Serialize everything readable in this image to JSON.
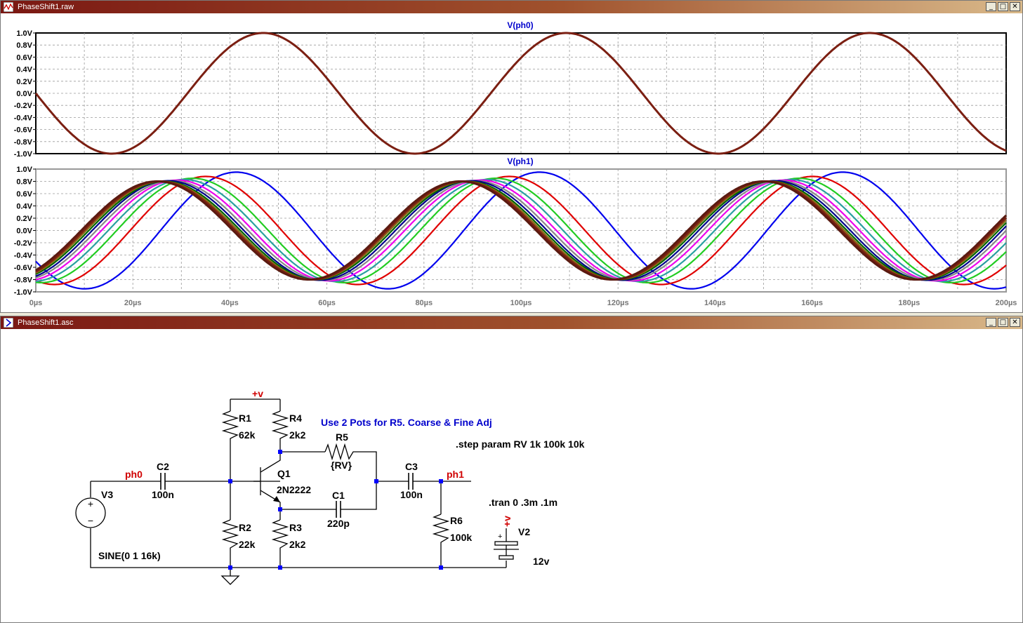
{
  "waveform_window": {
    "title": "PhaseShift1.raw",
    "buttons": {
      "minimize": "_",
      "maximize": "□",
      "close": "✕"
    }
  },
  "schematic_window": {
    "title": "PhaseShift1.asc",
    "buttons": {
      "minimize": "_",
      "maximize": "□",
      "close": "✕"
    }
  },
  "chart_data": [
    {
      "type": "line",
      "title": "V(ph0)",
      "xlim": [
        0,
        200
      ],
      "ylim": [
        -1.0,
        1.0
      ],
      "ytick_labels": [
        "1.0V",
        "0.8V",
        "0.6V",
        "0.4V",
        "0.2V",
        "0.0V",
        "-0.2V",
        "-0.4V",
        "-0.6V",
        "-0.8V",
        "-1.0V"
      ],
      "grid": true,
      "series": [
        {
          "color": "#7b1f12",
          "amplitude": 1.0,
          "phase_deg": 180,
          "frequency_khz": 16
        }
      ]
    },
    {
      "type": "line",
      "title": "V(ph1)",
      "xlim": [
        0,
        200
      ],
      "ylim": [
        -1.0,
        1.0
      ],
      "ytick_labels": [
        "1.0V",
        "0.8V",
        "0.6V",
        "0.4V",
        "0.2V",
        "0.0V",
        "-0.2V",
        "-0.4V",
        "-0.6V",
        "-0.8V",
        "-1.0V"
      ],
      "xtick_labels": [
        "0µs",
        "20µs",
        "40µs",
        "60µs",
        "80µs",
        "100µs",
        "120µs",
        "140µs",
        "160µs",
        "180µs",
        "200µs"
      ],
      "grid": true,
      "series": [
        {
          "color": "#0000ee",
          "amplitude": 0.95,
          "phase_deg": 212
        },
        {
          "color": "#e00000",
          "amplitude": 0.88,
          "phase_deg": 248
        },
        {
          "color": "#22cc22",
          "amplitude": 0.85,
          "phase_deg": 264
        },
        {
          "color": "#2aa0a0",
          "amplitude": 0.83,
          "phase_deg": 274
        },
        {
          "color": "#ee00ee",
          "amplitude": 0.82,
          "phase_deg": 282
        },
        {
          "color": "#888888",
          "amplitude": 0.81,
          "phase_deg": 288
        },
        {
          "color": "#00008b",
          "amplitude": 0.81,
          "phase_deg": 293
        },
        {
          "color": "#006400",
          "amplitude": 0.8,
          "phase_deg": 297
        },
        {
          "color": "#8b6914",
          "amplitude": 0.8,
          "phase_deg": 300
        },
        {
          "color": "#7b1f12",
          "amplitude": 0.8,
          "phase_deg": 303
        },
        {
          "color": "#5a1a10",
          "amplitude": 0.8,
          "phase_deg": 306
        }
      ]
    }
  ],
  "schematic": {
    "net_labels": {
      "ph0": "ph0",
      "ph1": "ph1",
      "vplus1": "+v",
      "vplus2": "+v"
    },
    "comment": "Use 2 Pots for R5. Coarse & Fine Adj",
    "directive_step": ".step param RV 1k  100k 10k",
    "directive_tran": ".tran 0 .3m .1m",
    "components": {
      "R1": {
        "name": "R1",
        "value": "62k"
      },
      "R2": {
        "name": "R2",
        "value": "22k"
      },
      "R3": {
        "name": "R3",
        "value": "2k2"
      },
      "R4": {
        "name": "R4",
        "value": "2k2"
      },
      "R5": {
        "name": "R5",
        "value": "{RV}"
      },
      "R6": {
        "name": "R6",
        "value": "100k"
      },
      "C1": {
        "name": "C1",
        "value": "220p"
      },
      "C2": {
        "name": "C2",
        "value": "100n"
      },
      "C3": {
        "name": "C3",
        "value": "100n"
      },
      "Q1": {
        "name": "Q1",
        "value": "2N2222"
      },
      "V2": {
        "name": "V2",
        "value": "12v"
      },
      "V3": {
        "name": "V3",
        "value": "SINE(0 1 16k)"
      }
    },
    "colors": {
      "net_label": "#d00000",
      "comment": "#0000cc",
      "wire": "#000000",
      "junction": "#0000ff"
    }
  }
}
